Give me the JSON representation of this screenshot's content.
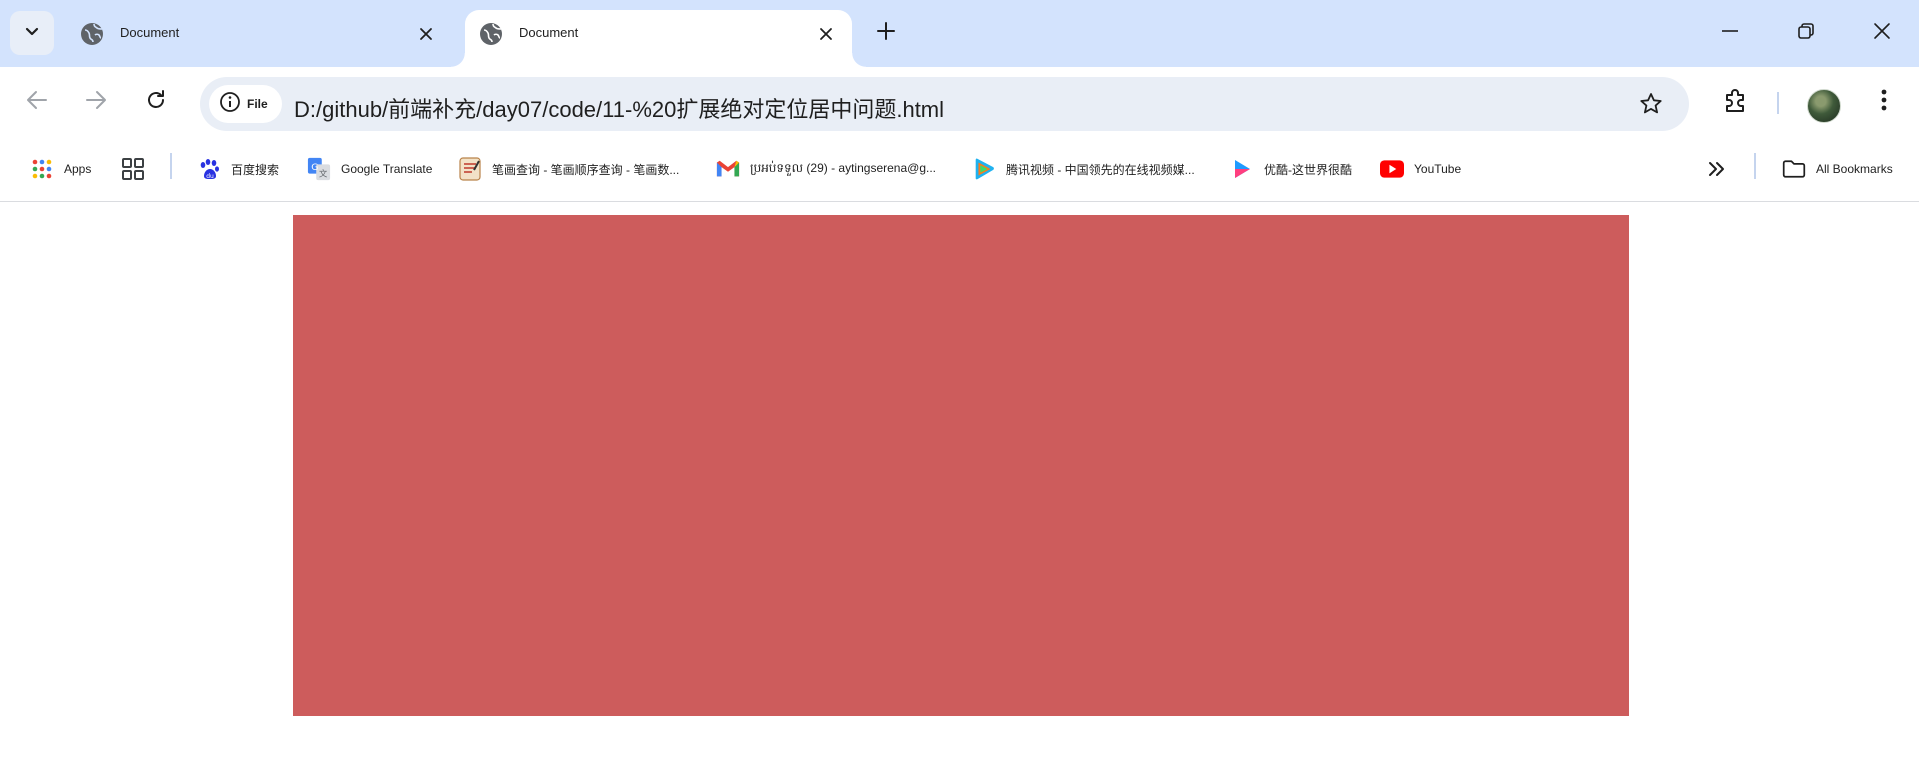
{
  "tabs": [
    {
      "title": "Document",
      "active": false
    },
    {
      "title": "Document",
      "active": true
    }
  ],
  "toolbar": {
    "site_chip_label": "File",
    "url": "D:/github/前端补充/day07/code/11-%20扩展绝对定位居中问题.html"
  },
  "bookmarks": {
    "items": [
      {
        "label": "Apps",
        "icon": "apps-grid-icon"
      },
      {
        "label": "",
        "icon": "tab-groups-icon"
      },
      {
        "label": "百度搜索",
        "icon": "baidu-paw-icon"
      },
      {
        "label": "Google Translate",
        "icon": "google-translate-icon"
      },
      {
        "label": "笔画查询 - 笔画顺序查询 - 笔画数...",
        "icon": "bihua-icon"
      },
      {
        "label": "ប្រអប់ទទួល (29) - aytingserena@g...",
        "icon": "gmail-icon"
      },
      {
        "label": "腾讯视频 - 中国领先的在线视频媒...",
        "icon": "tencent-video-icon"
      },
      {
        "label": "优酷-这世界很酷",
        "icon": "youku-icon"
      },
      {
        "label": "YouTube",
        "icon": "youtube-icon"
      }
    ],
    "all_bookmarks_label": "All Bookmarks"
  },
  "colors": {
    "tabstrip_bg": "#d3e3fd",
    "omnibox_bg": "#e9eef6",
    "red_box": "#cd5c5c"
  }
}
